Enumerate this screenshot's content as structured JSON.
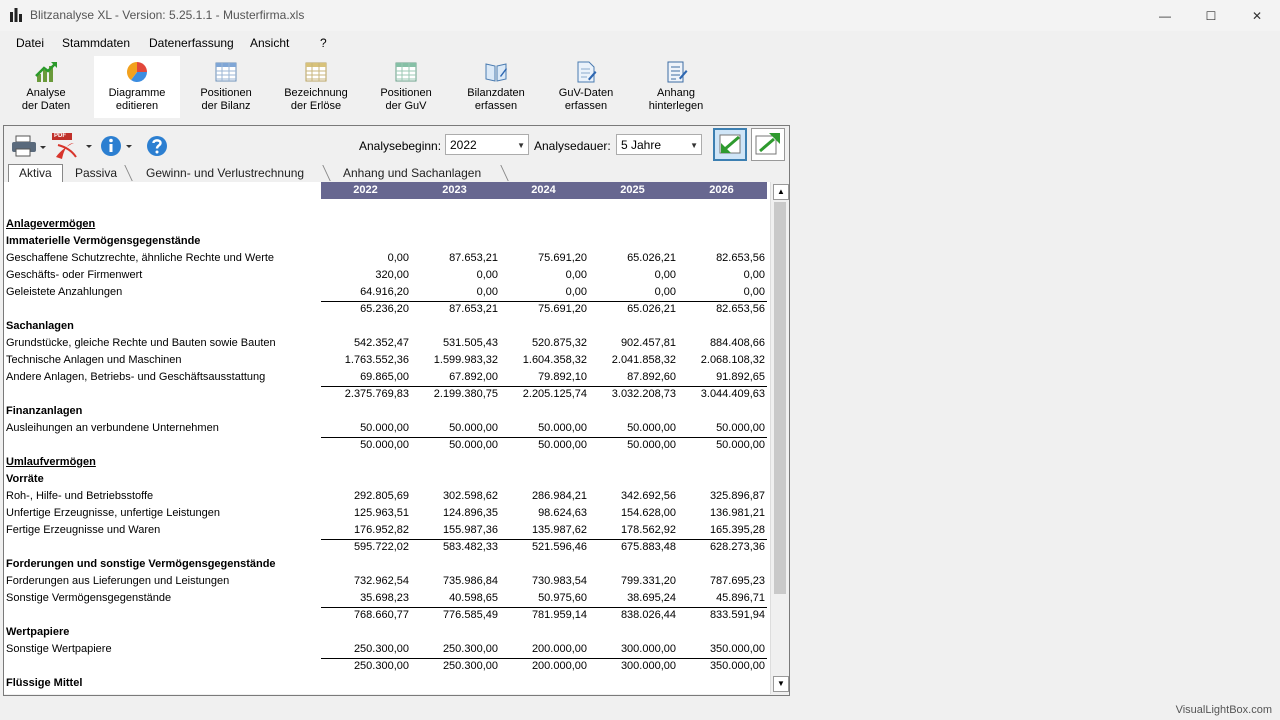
{
  "window": {
    "title": "Blitzanalyse XL - Version: 5.25.1.1 - Musterfirma.xls",
    "minimize_glyph": "—",
    "maximize_glyph": "☐",
    "close_glyph": "✕"
  },
  "menu": [
    "Datei",
    "Stammdaten",
    "Datenerfassung",
    "Ansicht",
    "?"
  ],
  "toolbar": [
    {
      "line1": "Analyse",
      "line2": "der Daten",
      "icon": "chart-analysis-icon"
    },
    {
      "line1": "Diagramme",
      "line2": "editieren",
      "icon": "pie-chart-icon"
    },
    {
      "line1": "Positionen",
      "line2": "der Bilanz",
      "icon": "table-icon"
    },
    {
      "line1": "Bezeichnung",
      "line2": "der Erlöse",
      "icon": "table-icon"
    },
    {
      "line1": "Positionen",
      "line2": "der GuV",
      "icon": "table-icon"
    },
    {
      "line1": "Bilanzdaten",
      "line2": "erfassen",
      "icon": "book-edit-icon"
    },
    {
      "line1": "GuV-Daten",
      "line2": "erfassen",
      "icon": "document-edit-icon"
    },
    {
      "line1": "Anhang",
      "line2": "hinterlegen",
      "icon": "notes-icon"
    }
  ],
  "controls": {
    "analysebeginn_label": "Analysebeginn:",
    "analysebeginn_value": "2022",
    "analysedauer_label": "Analysedauer:",
    "analysedauer_value": "5 Jahre",
    "pdf_label": "PDF"
  },
  "tabs": [
    "Aktiva",
    "Passiva",
    "Gewinn- und Verlustrechnung",
    "Anhang und Sachanlagen"
  ],
  "years": [
    "2022",
    "2023",
    "2024",
    "2025",
    "2026"
  ],
  "rows": [
    {
      "type": "blank",
      "label": "",
      "values": []
    },
    {
      "type": "section",
      "label": "Anlagevermögen",
      "values": []
    },
    {
      "type": "heading",
      "label": "Immaterielle Vermögensgegenstände",
      "values": []
    },
    {
      "type": "item",
      "label": "Geschaffene Schutzrechte, ähnliche Rechte und Werte",
      "values": [
        "0,00",
        "87.653,21",
        "75.691,20",
        "65.026,21",
        "82.653,56"
      ]
    },
    {
      "type": "item",
      "label": "Geschäfts- oder Firmenwert",
      "values": [
        "320,00",
        "0,00",
        "0,00",
        "0,00",
        "0,00"
      ]
    },
    {
      "type": "item",
      "label": "Geleistete Anzahlungen",
      "values": [
        "64.916,20",
        "0,00",
        "0,00",
        "0,00",
        "0,00"
      ]
    },
    {
      "type": "sum",
      "label": "",
      "values": [
        "65.236,20",
        "87.653,21",
        "75.691,20",
        "65.026,21",
        "82.653,56"
      ]
    },
    {
      "type": "heading",
      "label": "Sachanlagen",
      "values": []
    },
    {
      "type": "item",
      "label": "Grundstücke, gleiche Rechte und Bauten sowie Bauten",
      "values": [
        "542.352,47",
        "531.505,43",
        "520.875,32",
        "902.457,81",
        "884.408,66"
      ]
    },
    {
      "type": "item",
      "label": "Technische Anlagen und Maschinen",
      "values": [
        "1.763.552,36",
        "1.599.983,32",
        "1.604.358,32",
        "2.041.858,32",
        "2.068.108,32"
      ]
    },
    {
      "type": "item",
      "label": "Andere Anlagen, Betriebs- und Geschäftsausstattung",
      "values": [
        "69.865,00",
        "67.892,00",
        "79.892,10",
        "87.892,60",
        "91.892,65"
      ]
    },
    {
      "type": "sum",
      "label": "",
      "values": [
        "2.375.769,83",
        "2.199.380,75",
        "2.205.125,74",
        "3.032.208,73",
        "3.044.409,63"
      ]
    },
    {
      "type": "heading",
      "label": "Finanzanlagen",
      "values": []
    },
    {
      "type": "item",
      "label": "Ausleihungen an verbundene Unternehmen",
      "values": [
        "50.000,00",
        "50.000,00",
        "50.000,00",
        "50.000,00",
        "50.000,00"
      ]
    },
    {
      "type": "sum",
      "label": "",
      "values": [
        "50.000,00",
        "50.000,00",
        "50.000,00",
        "50.000,00",
        "50.000,00"
      ]
    },
    {
      "type": "section",
      "label": "Umlaufvermögen",
      "values": []
    },
    {
      "type": "heading",
      "label": "Vorräte",
      "values": []
    },
    {
      "type": "item",
      "label": "Roh-, Hilfe- und Betriebsstoffe",
      "values": [
        "292.805,69",
        "302.598,62",
        "286.984,21",
        "342.692,56",
        "325.896,87"
      ]
    },
    {
      "type": "item",
      "label": "Unfertige Erzeugnisse, unfertige Leistungen",
      "values": [
        "125.963,51",
        "124.896,35",
        "98.624,63",
        "154.628,00",
        "136.981,21"
      ]
    },
    {
      "type": "item",
      "label": "Fertige Erzeugnisse und Waren",
      "values": [
        "176.952,82",
        "155.987,36",
        "135.987,62",
        "178.562,92",
        "165.395,28"
      ]
    },
    {
      "type": "sum",
      "label": "",
      "values": [
        "595.722,02",
        "583.482,33",
        "521.596,46",
        "675.883,48",
        "628.273,36"
      ]
    },
    {
      "type": "heading",
      "label": "Forderungen und sonstige Vermögensgegenstände",
      "values": []
    },
    {
      "type": "item",
      "label": "Forderungen aus Lieferungen und Leistungen",
      "values": [
        "732.962,54",
        "735.986,84",
        "730.983,54",
        "799.331,20",
        "787.695,23"
      ]
    },
    {
      "type": "item",
      "label": "Sonstige Vermögensgegenstände",
      "values": [
        "35.698,23",
        "40.598,65",
        "50.975,60",
        "38.695,24",
        "45.896,71"
      ]
    },
    {
      "type": "sum",
      "label": "",
      "values": [
        "768.660,77",
        "776.585,49",
        "781.959,14",
        "838.026,44",
        "833.591,94"
      ]
    },
    {
      "type": "heading",
      "label": "Wertpapiere",
      "values": []
    },
    {
      "type": "item",
      "label": "Sonstige Wertpapiere",
      "values": [
        "250.300,00",
        "250.300,00",
        "200.000,00",
        "300.000,00",
        "350.000,00"
      ]
    },
    {
      "type": "sum",
      "label": "",
      "values": [
        "250.300,00",
        "250.300,00",
        "200.000,00",
        "300.000,00",
        "350.000,00"
      ]
    },
    {
      "type": "heading",
      "label": "Flüssige Mittel",
      "values": []
    }
  ],
  "watermark": "VisualLightBox.com"
}
